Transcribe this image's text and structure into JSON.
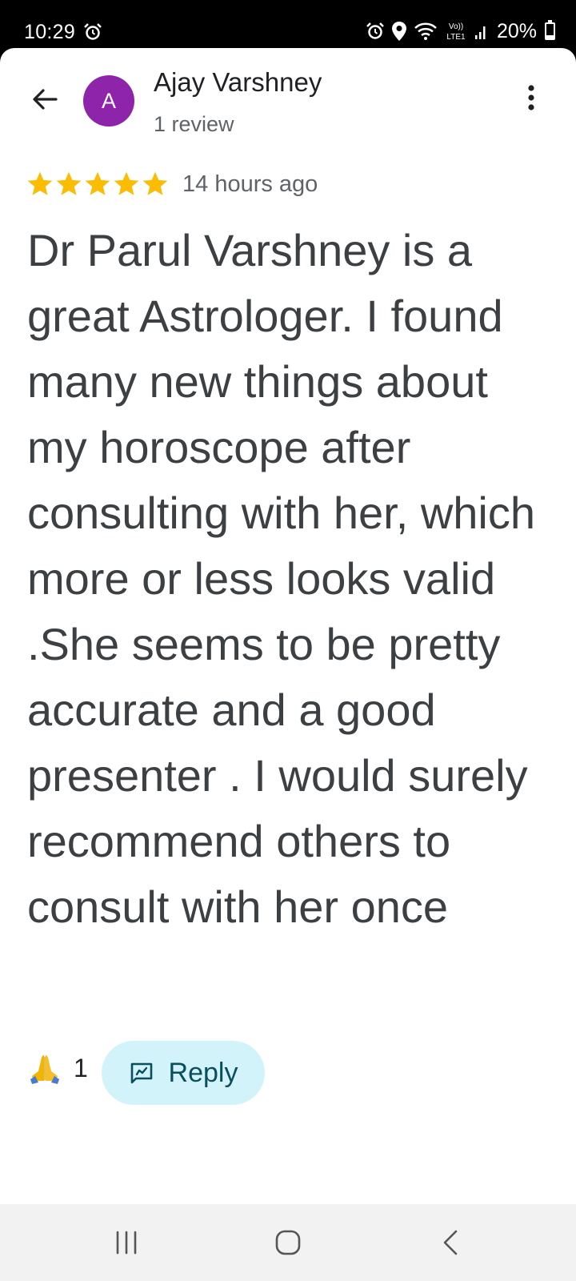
{
  "status_bar": {
    "time": "10:29",
    "battery_text": "20%",
    "battery_level": 0.2,
    "network_label": "Vo)) LTE1",
    "icons": [
      "alarm-icon",
      "location-icon",
      "wifi-icon",
      "signal-icon",
      "battery-icon"
    ]
  },
  "header": {
    "back_icon": "arrow-back-icon",
    "avatar_letter": "A",
    "avatar_color": "#8e24aa",
    "name": "Ajay Varshney",
    "meta": "1 review",
    "more_icon": "more-vert-icon"
  },
  "review": {
    "rating": 5,
    "rating_max": 5,
    "star_color": "#fbbc04",
    "time": "14 hours ago",
    "text": "Dr Parul Varshney is a great Astrologer. I found many new things about my horoscope after consulting with her, which more or less looks valid .She seems to be pretty accurate and a good presenter . I would surely recommend others to consult with her once"
  },
  "actions": {
    "reaction_icon": "folded-hands-icon",
    "reaction_count": "1",
    "reply_label": "Reply",
    "reply_bg": "#d3f3fb",
    "reply_text_color": "#0b4f5c"
  },
  "nav_bar": {
    "icons": [
      "recents-icon",
      "home-icon",
      "back-icon"
    ]
  }
}
